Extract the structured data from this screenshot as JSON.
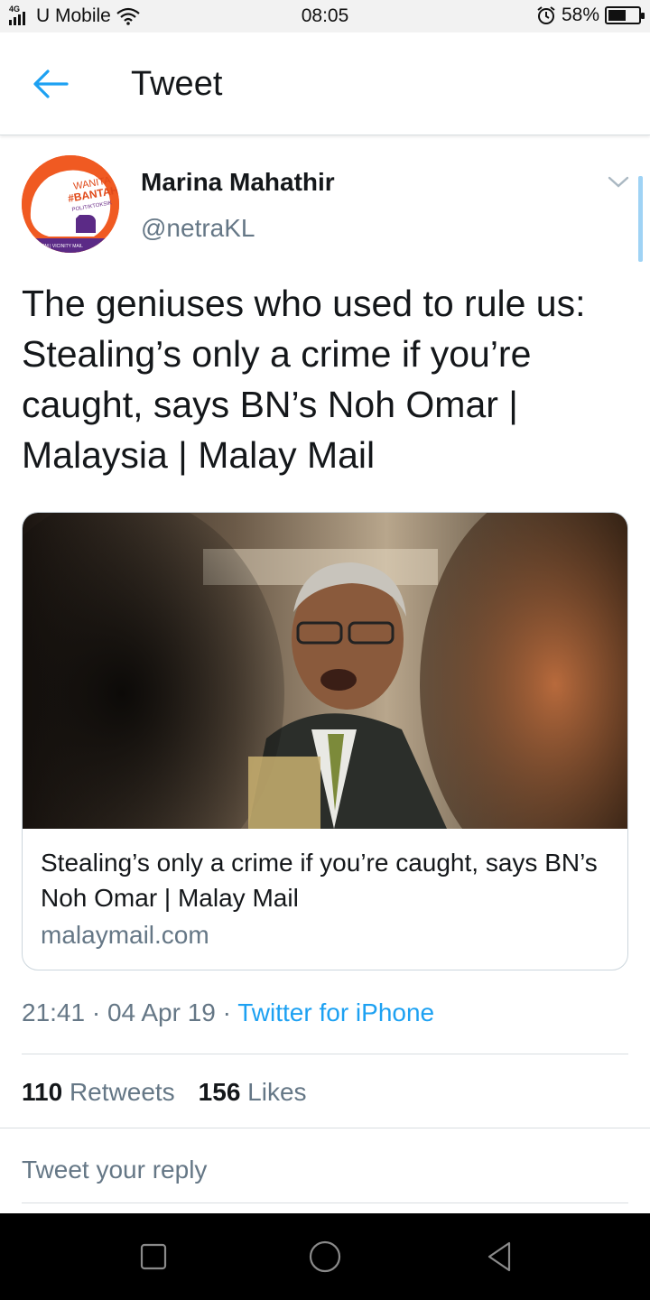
{
  "status_bar": {
    "network": "4G",
    "carrier": "U Mobile",
    "time": "08:05",
    "battery_percent": "58%",
    "battery_level": 0.58
  },
  "header": {
    "title": "Tweet",
    "back_icon": "arrow-left-icon",
    "accent_color": "#1da1f2"
  },
  "author": {
    "name": "Marina Mahathir",
    "handle": "@netraKL",
    "avatar_text": [
      "WANITA",
      "#BANTAH",
      "POLITIKTOKSIK",
      "RM | VICINITY MAIL"
    ]
  },
  "tweet": {
    "text": "The geniuses who used to rule us: Stealing’s only a crime if you’re caught, says BN’s Noh Omar | Malaysia | Malay Mail"
  },
  "card": {
    "title": "Stealing’s only a crime if you’re caught, says BN’s Noh Omar | Malay Mail",
    "domain": "malaymail.com"
  },
  "meta": {
    "time": "21:41",
    "date": "04 Apr 19",
    "separator": "·",
    "source": "Twitter for iPhone"
  },
  "stats": {
    "retweets_count": "110",
    "retweets_label": "Retweets",
    "likes_count": "156",
    "likes_label": "Likes"
  },
  "reply": {
    "placeholder": "Tweet your reply"
  },
  "nav": {
    "icons": [
      "recent-apps-icon",
      "home-icon",
      "back-triangle-icon"
    ]
  }
}
